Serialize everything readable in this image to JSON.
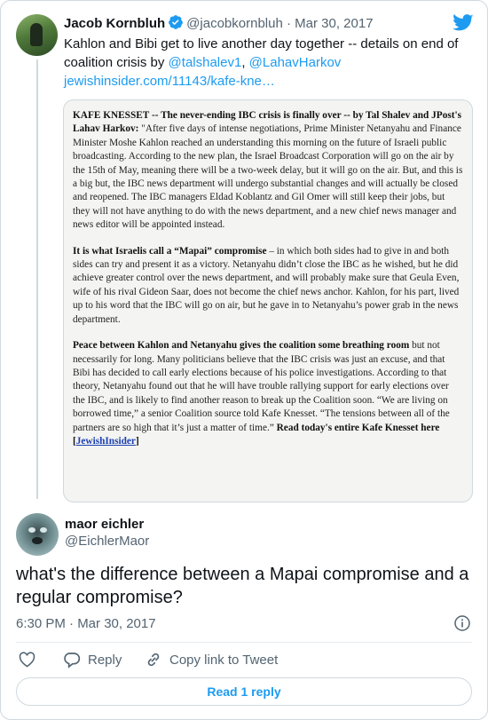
{
  "quoted_tweet": {
    "author_name": "Jacob Kornbluh",
    "author_handle": "@jacobkornbluh",
    "separator": "·",
    "date": "Mar 30, 2017",
    "text_before": "Kahlon and Bibi get to live another day together -- details on end of coalition crisis by ",
    "mention_1": "@talshalev1",
    "comma": ", ",
    "mention_2": "@LahavHarkov",
    "link": "jewishinsider.com/11143/kafe-kne…",
    "icons": {
      "verified": "verified-badge-icon",
      "brand": "twitter-bird-icon"
    },
    "article": {
      "p1_bold": "KAFE KNESSET -- The never-ending IBC crisis is finally over -- by Tal Shalev and JPost's Lahav Harkov:",
      "p1_text": " \"After five days of intense negotiations, Prime Minister Netanyahu and Finance Minister Moshe Kahlon reached an understanding this morning on the future of Israeli public broadcasting. According to the new plan, the Israel Broadcast Corporation will go on the air by the 15th of May, meaning there will be a two-week delay, but it will go on the air. But, and this is a big but, the IBC news department will undergo substantial changes and will actually be closed and reopened. The IBC managers Eldad Koblantz and Gil Omer will still keep their jobs, but they will not have anything to do with the news department, and a new chief news manager and news editor will be appointed instead.",
      "p2_bold": "It is what Israelis call a “Mapai” compromise",
      "p2_text": " – in which both sides had to give in and both sides can try and present it as a victory. Netanyahu didn’t close the IBC as he wished, but he did achieve greater control over the news department, and will probably make sure that Geula Even, wife of his rival Gideon Saar, does not become the chief news anchor. Kahlon, for his part, lived up to his word that the IBC will go on air, but he gave in to Netanyahu’s power grab in the news department.",
      "p3_bold": "Peace between Kahlon and Netanyahu gives the coalition some breathing room",
      "p3_text": " but not necessarily for long. Many politicians believe that the IBC crisis was just an excuse, and that Bibi has decided to call early elections because of his police investigations. According to that theory, Netanyahu found out that he will have trouble rallying support for early elections over the IBC, and is likely to find another reason to break up the Coalition soon. “We are living on borrowed time,” a senior Coalition source told Kafe Knesset. “The tensions between all of the partners are so high that it’s just a matter of time.” ",
      "p3_end_bold": "Read today's entire Kafe Knesset here [",
      "p3_link": "JewishInsider",
      "p3_close": "]"
    }
  },
  "reply_tweet": {
    "author_name": "maor eichler",
    "author_handle": "@EichlerMaor",
    "text": "what's the difference between a Mapai compromise and a regular compromise?",
    "timestamp": "6:30 PM · Mar 30, 2017",
    "info_icon": "info-icon"
  },
  "actions": {
    "reply_label": "Reply",
    "copy_label": "Copy link to Tweet",
    "icons": [
      "heart-icon",
      "reply-icon",
      "link-icon"
    ]
  },
  "read_button": "Read 1 reply",
  "colors": {
    "accent": "#1d9bf0",
    "text": "#0f1419",
    "secondary": "#536471",
    "border": "#cfd9de"
  }
}
